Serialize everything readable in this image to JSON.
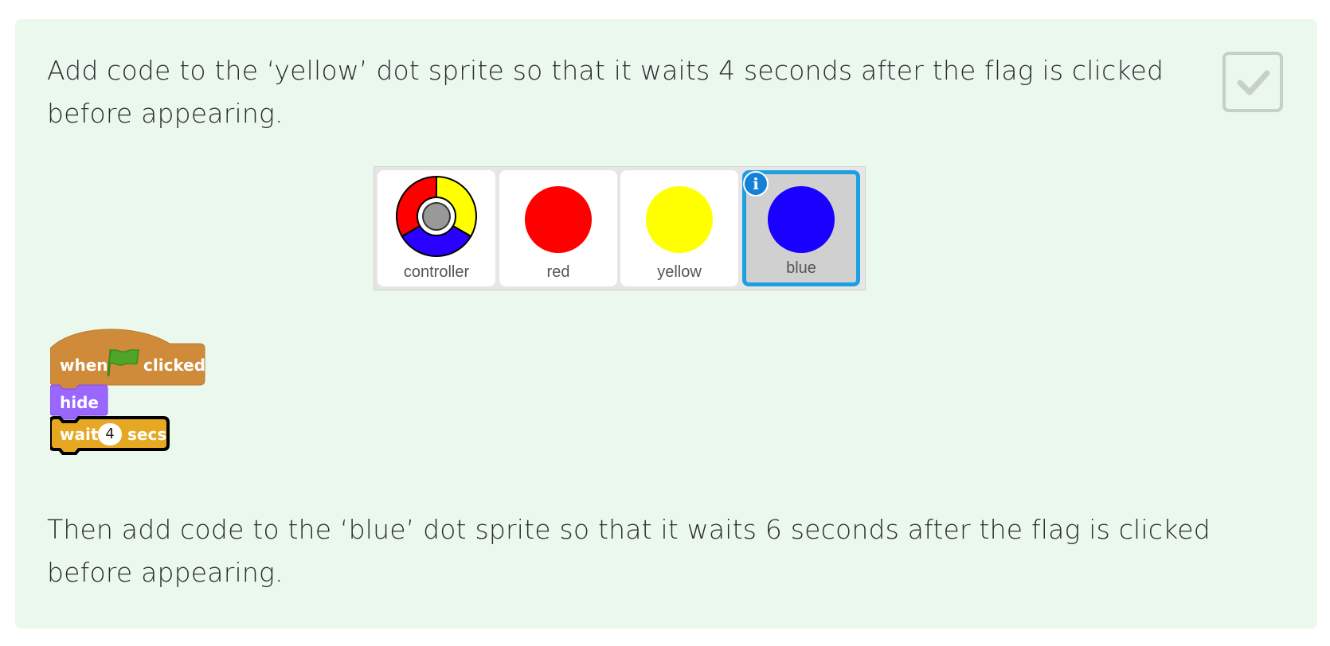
{
  "instructions": {
    "paragraph_1": "Add code to the ‘yellow’ dot sprite so that it waits 4 seconds after the flag is clicked before appearing.",
    "paragraph_2": "Then add code to the ‘blue’ dot sprite so that it waits 6 seconds after the flag is clicked before appearing."
  },
  "completion_checkbox": {
    "checked": true,
    "icon": "checkmark-icon"
  },
  "sprites": [
    {
      "label": "controller",
      "icon": "controller-wheel-icon",
      "selected": false
    },
    {
      "label": "red",
      "icon": "dot-icon",
      "color": "#ff0000",
      "selected": false
    },
    {
      "label": "yellow",
      "icon": "dot-icon",
      "color": "#ffff00",
      "selected": false
    },
    {
      "label": "blue",
      "icon": "dot-icon",
      "color": "#1a00ff",
      "selected": true,
      "info_badge": "i"
    }
  ],
  "script_blocks": {
    "hat": {
      "before": "when",
      "icon": "green-flag-icon",
      "after": "clicked",
      "color": "#cf8b3a"
    },
    "hide": {
      "label": "hide",
      "color": "#9966ff"
    },
    "wait": {
      "before": "wait",
      "value": "4",
      "after": "secs",
      "color": "#e6a823"
    }
  },
  "colors": {
    "card_background": "#eaf8ee",
    "selected_border": "#1da0e0"
  }
}
